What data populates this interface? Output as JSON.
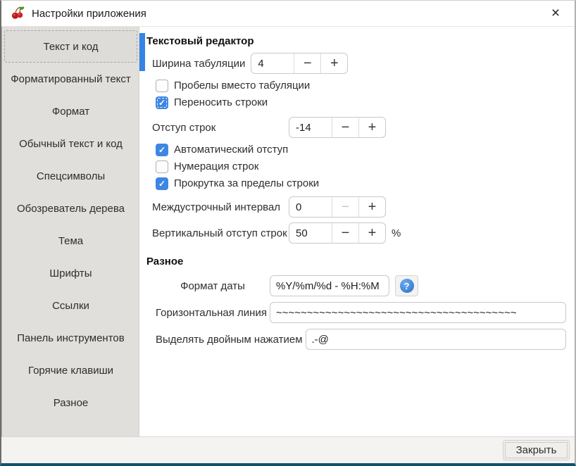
{
  "window": {
    "title": "Настройки приложения"
  },
  "icons": {
    "app": "cherries-icon",
    "close": "×",
    "minus": "−",
    "plus": "+",
    "help": "?",
    "check": "✓"
  },
  "colors": {
    "accent": "#3584e4",
    "checkbox_checked": "#3d87e3",
    "sidebar_bg": "#e1dfdb",
    "window_bottom_border": "#14506e"
  },
  "sidebar": {
    "selected_index": 0,
    "items": [
      "Текст и код",
      "Форматированный текст",
      "Формат",
      "Обычный текст и код",
      "Спецсимволы",
      "Обозреватель дерева",
      "Тема",
      "Шрифты",
      "Ссылки",
      "Панель инструментов",
      "Горячие клавиши",
      "Разное"
    ]
  },
  "editor_section": {
    "heading": "Текстовый редактор",
    "tab_width": {
      "label": "Ширина табуляции",
      "value": "4"
    },
    "spaces_instead_tabs": {
      "label": "Пробелы вместо табуляции",
      "checked": false
    },
    "line_wrap": {
      "label": "Переносить строки",
      "checked": true
    },
    "line_indent": {
      "label": "Отступ строк",
      "value": "-14"
    },
    "auto_indent": {
      "label": "Автоматический отступ",
      "checked": true
    },
    "line_numbers": {
      "label": "Нумерация строк",
      "checked": false
    },
    "scroll_beyond_end": {
      "label": "Прокрутка за пределы строки",
      "checked": true
    },
    "line_spacing": {
      "label": "Междустрочный интервал",
      "value": "0",
      "minus_disabled": true
    },
    "vertical_space": {
      "label": "Вертикальный отступ строк",
      "value": "50",
      "suffix": "%"
    }
  },
  "misc_section": {
    "heading": "Разное",
    "date_format": {
      "label": "Формат даты",
      "value": "%Y/%m/%d - %H:%M"
    },
    "horizontal_rule": {
      "label": "Горизонтальная линия",
      "value": "~~~~~~~~~~~~~~~~~~~~~~~~~~~~~~~~~~~~~~~"
    },
    "double_click_select": {
      "label": "Выделять двойным нажатием",
      "value": ".-@"
    }
  },
  "footer": {
    "close_label": "Закрыть"
  }
}
